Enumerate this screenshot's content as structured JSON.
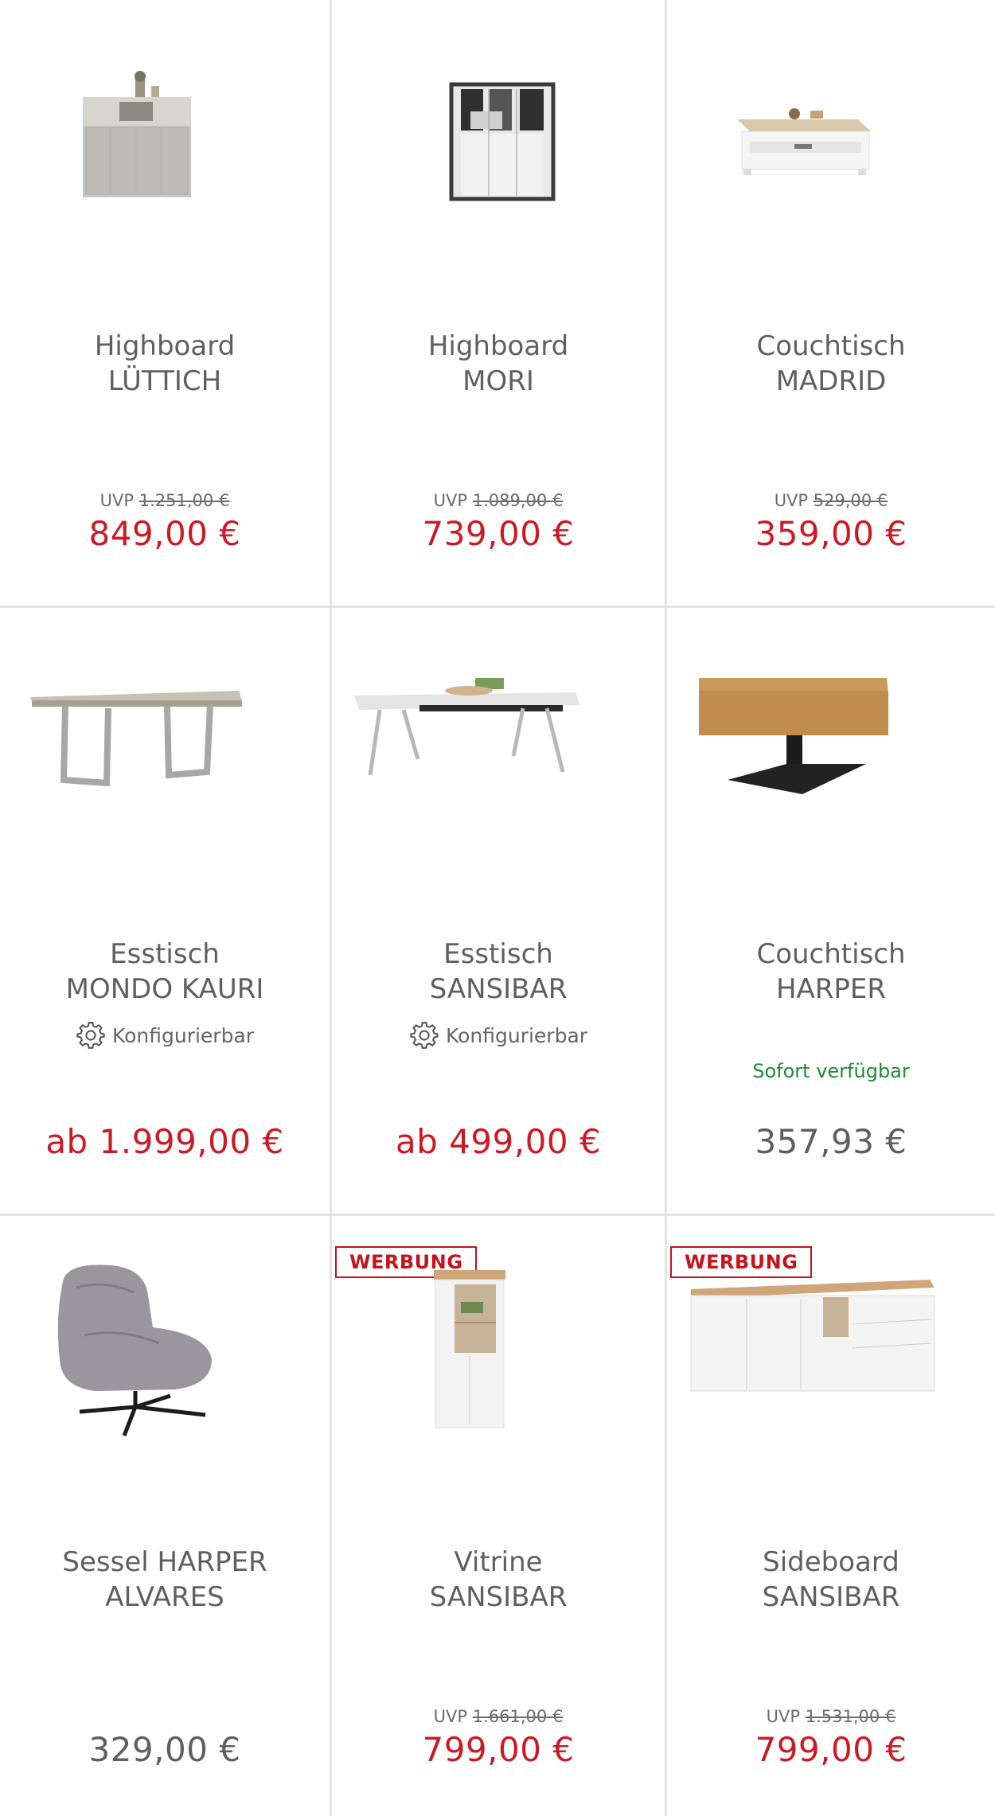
{
  "products": [
    {
      "line1": "Highboard",
      "line2": "LÜTTICH",
      "uvp_label": "UVP",
      "uvp_price": "1.251,00 €",
      "price": "849,00 €",
      "icon": "highboard-image"
    },
    {
      "line1": "Highboard",
      "line2": "MORI",
      "uvp_label": "UVP",
      "uvp_price": "1.089,00 €",
      "price": "739,00 €",
      "icon": "highboard-glass-image"
    },
    {
      "line1": "Couchtisch",
      "line2": "MADRID",
      "uvp_label": "UVP",
      "uvp_price": "529,00 €",
      "price": "359,00 €",
      "icon": "coffee-table-image"
    },
    {
      "line1": "Esstisch",
      "line2": "MONDO KAURI",
      "config_label": "Konfigurierbar",
      "price": "ab 1.999,00 €",
      "icon": "dining-table-image"
    },
    {
      "line1": "Esstisch",
      "line2": "SANSIBAR",
      "config_label": "Konfigurierbar",
      "price": "ab 499,00 €",
      "icon": "dining-table-white-image"
    },
    {
      "line1": "Couchtisch",
      "line2": "HARPER",
      "availability": "Sofort verfügbar",
      "price": "357,93 €",
      "icon": "coffee-table-oak-image"
    },
    {
      "line1": "Sessel HARPER",
      "line2": "ALVARES",
      "price": "329,00 €",
      "icon": "armchair-image"
    },
    {
      "line1": "Vitrine",
      "line2": "SANSIBAR",
      "badge": "WERBUNG",
      "uvp_label": "UVP",
      "uvp_price": "1.661,00 €",
      "price": "799,00 €",
      "icon": "vitrine-image"
    },
    {
      "line1": "Sideboard",
      "line2": "SANSIBAR",
      "badge": "WERBUNG",
      "uvp_label": "UVP",
      "uvp_price": "1.531,00 €",
      "price": "799,00 €",
      "icon": "sideboard-image"
    }
  ],
  "colors": {
    "sale_price": "#cc1a24",
    "badge": "#c5121b",
    "availability": "#1e8a3a"
  }
}
